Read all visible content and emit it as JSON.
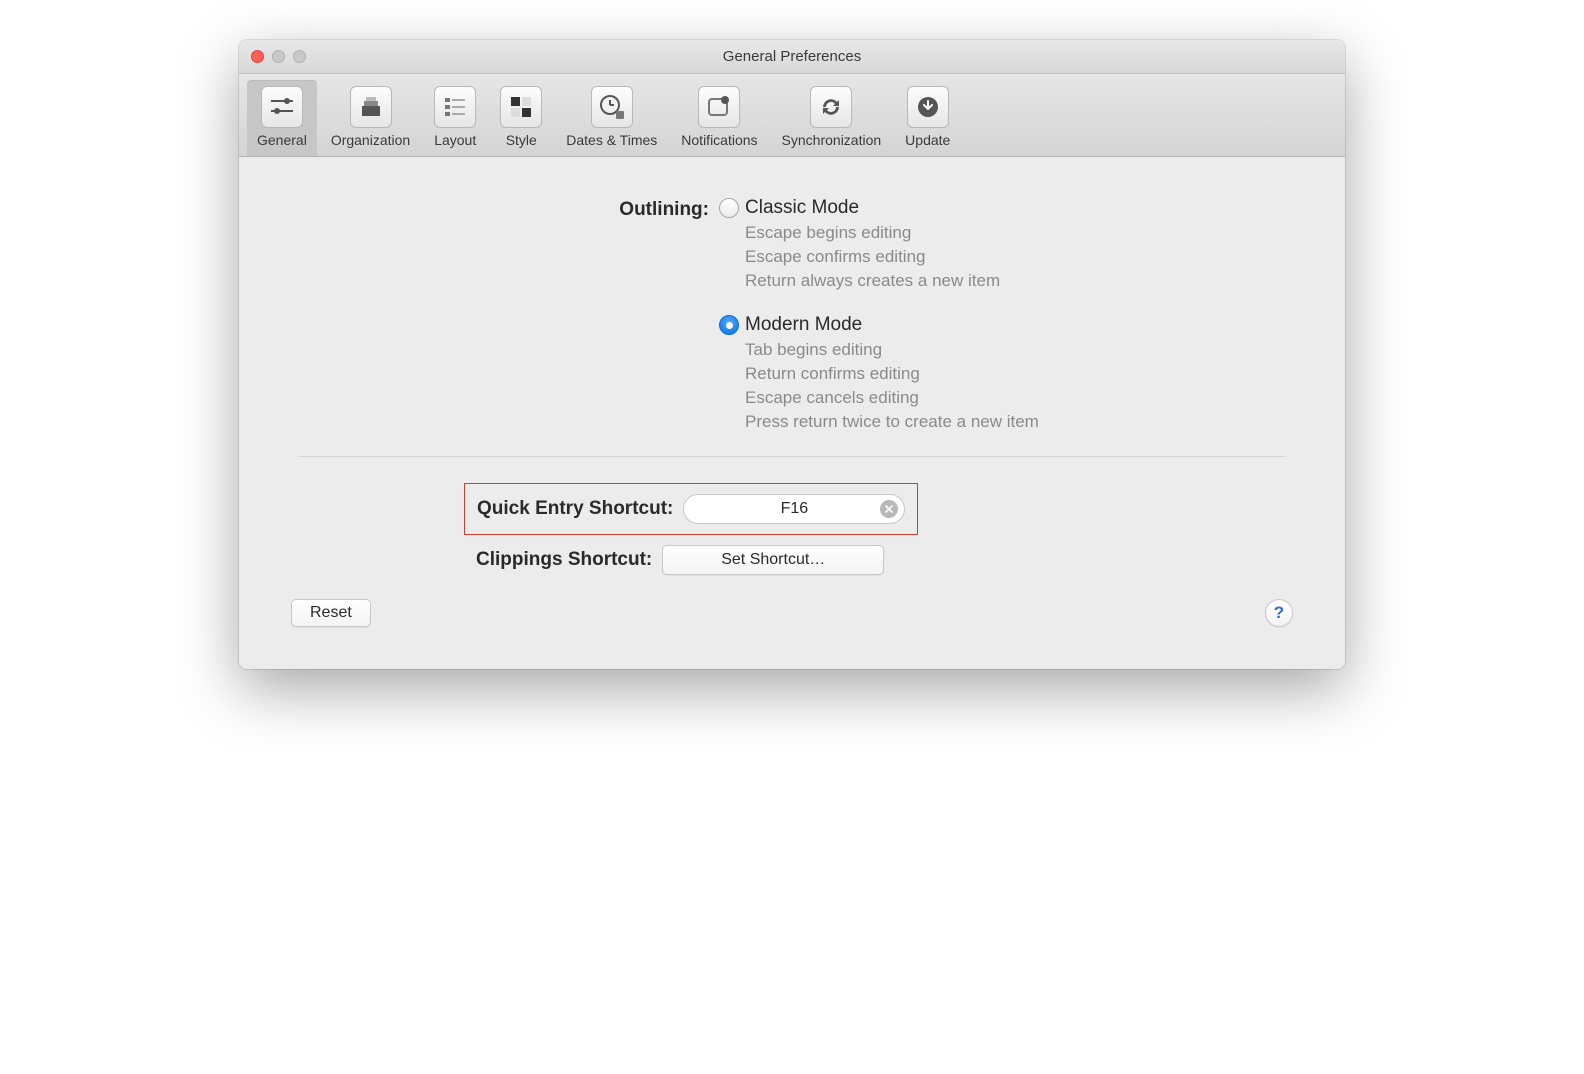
{
  "window": {
    "title": "General Preferences"
  },
  "toolbar": {
    "items": [
      {
        "label": "General"
      },
      {
        "label": "Organization"
      },
      {
        "label": "Layout"
      },
      {
        "label": "Style"
      },
      {
        "label": "Dates & Times"
      },
      {
        "label": "Notifications"
      },
      {
        "label": "Synchronization"
      },
      {
        "label": "Update"
      }
    ]
  },
  "outlining": {
    "label": "Outlining:",
    "classic": {
      "title": "Classic Mode",
      "desc1": "Escape begins editing",
      "desc2": "Escape confirms editing",
      "desc3": "Return always creates a new item"
    },
    "modern": {
      "title": "Modern Mode",
      "desc1": "Tab begins editing",
      "desc2": "Return confirms editing",
      "desc3": "Escape cancels editing",
      "desc4": "Press return twice to create a new item"
    }
  },
  "shortcuts": {
    "quick_entry_label": "Quick Entry Shortcut:",
    "quick_entry_value": "F16",
    "clippings_label": "Clippings Shortcut:",
    "clippings_button": "Set Shortcut…"
  },
  "footer": {
    "reset": "Reset",
    "help": "?"
  }
}
